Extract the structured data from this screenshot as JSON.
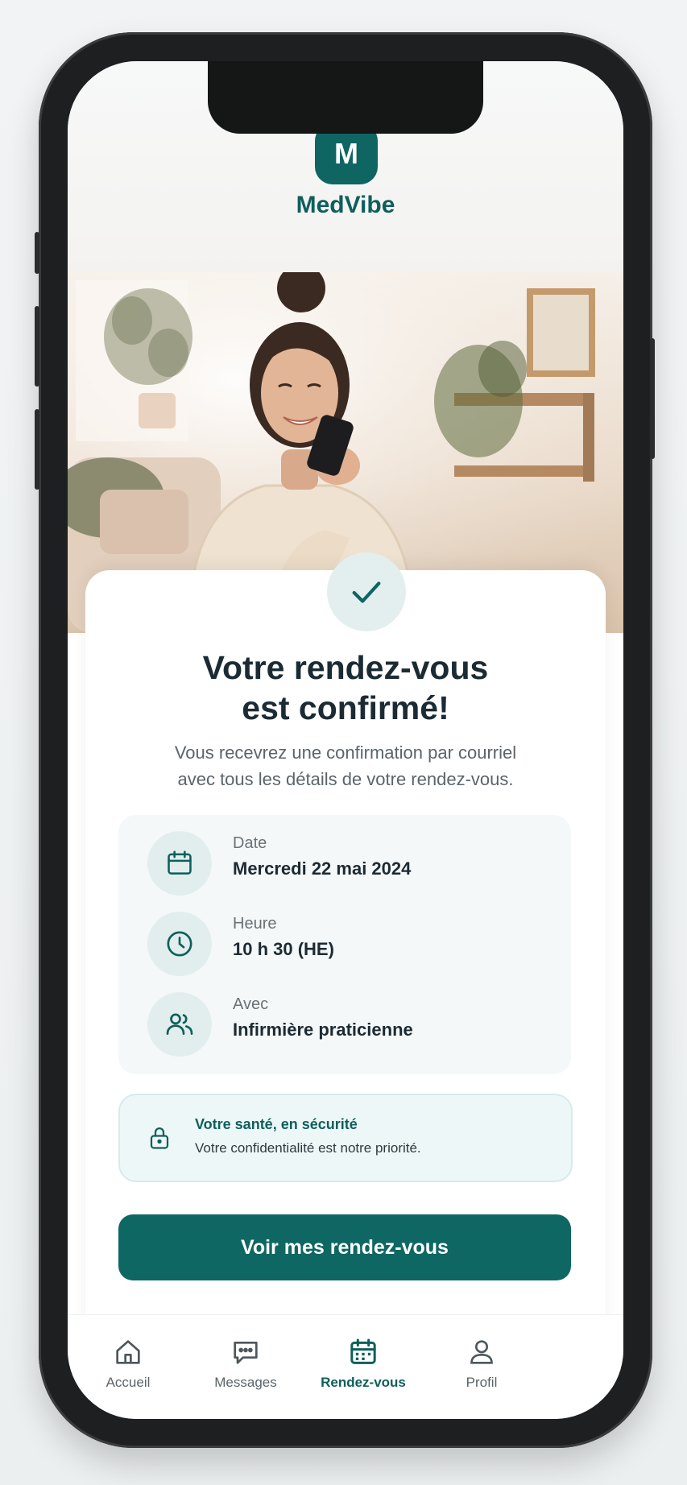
{
  "app": {
    "logo_letter": "M",
    "brand": "MedVibe"
  },
  "confirmation": {
    "title_line1": "Votre rendez-vous",
    "title_line2": "est confirmé!",
    "subtitle_line1": "Vous recevrez une confirmation par courriel",
    "subtitle_line2": "avec tous les détails de votre rendez-vous."
  },
  "details": [
    {
      "label": "Date",
      "value": "Mercredi 22 mai 2024",
      "icon": "calendar-icon"
    },
    {
      "label": "Heure",
      "value": "10 h 30 (HE)",
      "icon": "clock-icon"
    },
    {
      "label": "Avec",
      "value": "Infirmière praticienne",
      "icon": "users-icon"
    }
  ],
  "security": {
    "title": "Votre santé, en sécurité",
    "text": "Votre confidentialité est notre priorité.",
    "icon": "lock-icon"
  },
  "cta": {
    "label": "Voir mes rendez-vous"
  },
  "tabs": [
    {
      "label": "Accueil",
      "icon": "home-icon",
      "active": false
    },
    {
      "label": "Messages",
      "icon": "chat-icon",
      "active": false
    },
    {
      "label": "Rendez-vous",
      "icon": "calendar-icon",
      "active": true
    },
    {
      "label": "Profil",
      "icon": "user-icon",
      "active": false
    }
  ],
  "colors": {
    "primary": "#0e6763",
    "text_dark": "#1c2a33",
    "accent_light": "#e1eeed"
  }
}
